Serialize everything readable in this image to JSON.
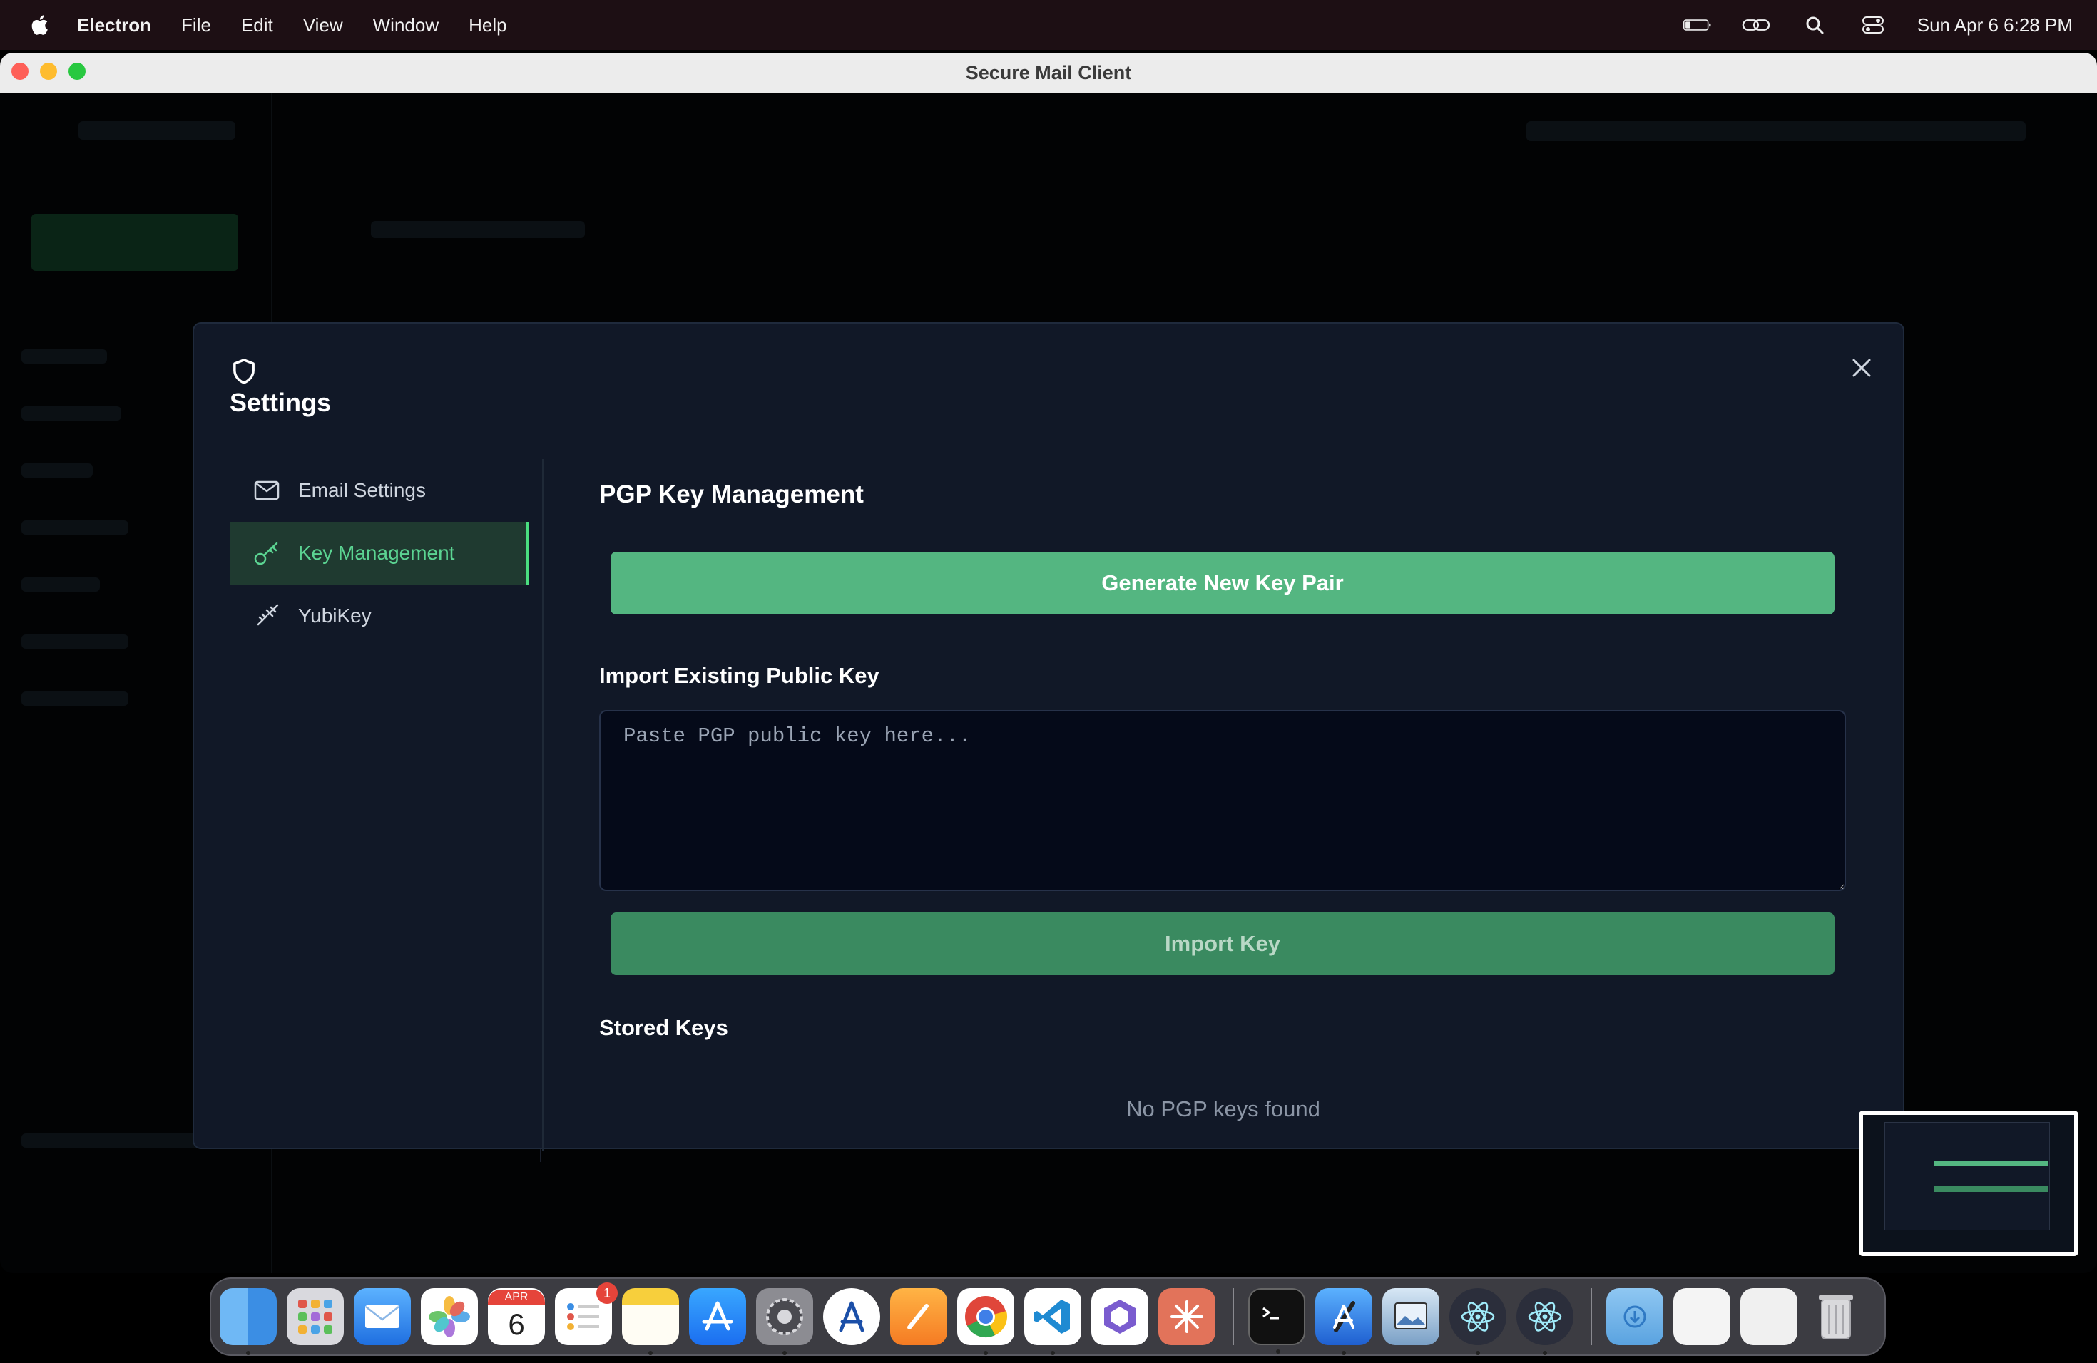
{
  "menubar": {
    "app_name": "Electron",
    "items": [
      "File",
      "Edit",
      "View",
      "Window",
      "Help"
    ],
    "clock": "Sun Apr 6  6:28 PM"
  },
  "window": {
    "title": "Secure Mail Client"
  },
  "settings": {
    "title": "Settings",
    "nav": [
      {
        "label": "Email Settings",
        "icon": "mail-icon",
        "active": false
      },
      {
        "label": "Key Management",
        "icon": "key-icon",
        "active": true
      },
      {
        "label": "YubiKey",
        "icon": "yubikey-icon",
        "active": false
      }
    ],
    "section_title": "PGP Key Management",
    "generate_button": "Generate New Key Pair",
    "import_title": "Import Existing Public Key",
    "import_placeholder": "Paste PGP public key here...",
    "import_button": "Import Key",
    "stored_title": "Stored Keys",
    "empty_message": "No PGP keys found"
  },
  "colors": {
    "accent": "#54b681",
    "accent_active_text": "#5bd492",
    "modal_bg": "#111827"
  },
  "dock": {
    "calendar_month": "APR",
    "calendar_day": "6",
    "reminders_badge": "1",
    "icons": [
      "finder-icon",
      "launchpad-icon",
      "mail-icon",
      "photos-icon",
      "calendar-icon",
      "reminders-icon",
      "notes-icon",
      "app-store-icon",
      "system-settings-icon",
      "xcode-instruments-icon",
      "pages-icon",
      "chrome-icon",
      "vscode-icon",
      "cube-app-icon",
      "spark-icon",
      "terminal-icon",
      "xcode-icon",
      "preview-icon",
      "electron-icon",
      "electron-icon-2",
      "downloads-folder-icon",
      "documents-stack-icon",
      "files-stack-icon",
      "trash-icon"
    ]
  }
}
